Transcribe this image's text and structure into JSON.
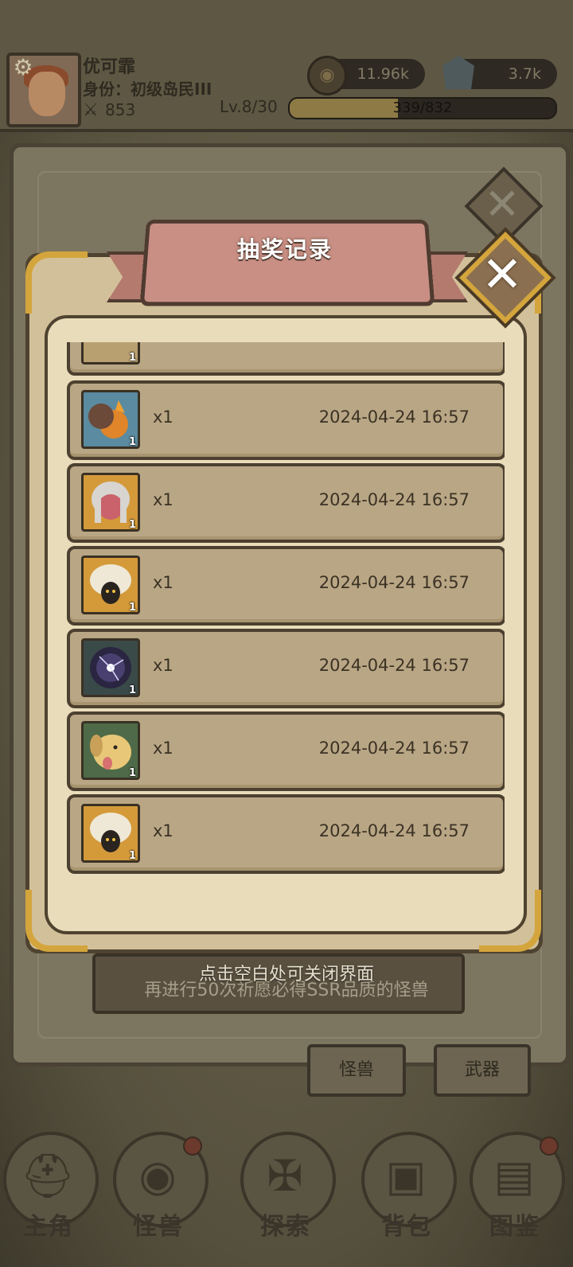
{
  "player": {
    "name": "优可霏",
    "role": "身份：初级岛民III",
    "power": "853",
    "level": "Lv.8/30",
    "xp_text": "339/832",
    "xp_progress": 0.407
  },
  "resources": {
    "coins": "11.96k",
    "gems": "3.7k"
  },
  "dialog": {
    "title": "抽奖记录",
    "records": [
      {
        "icon": "fire-beast-card-icon",
        "count": "1",
        "qty": "x1",
        "time": "2024-04-24 16:57",
        "color": "#5a8ba0"
      },
      {
        "icon": "red-girl-card-icon",
        "count": "1",
        "qty": "x1",
        "time": "2024-04-24 16:57",
        "color": "#d49a3a"
      },
      {
        "icon": "white-haired-imp-card-icon",
        "count": "1",
        "qty": "x1",
        "time": "2024-04-24 16:57",
        "color": "#d49a3a"
      },
      {
        "icon": "dark-orb-card-icon",
        "count": "1",
        "qty": "x1",
        "time": "2024-04-24 16:57",
        "color": "#3a4a48"
      },
      {
        "icon": "dog-card-icon",
        "count": "1",
        "qty": "x1",
        "time": "2024-04-24 16:57",
        "color": "#4e6a48"
      },
      {
        "icon": "white-haired-imp-card-icon",
        "count": "1",
        "qty": "x1",
        "time": "2024-04-24 16:57",
        "color": "#d49a3a"
      }
    ],
    "partial_record_count": "1"
  },
  "hints": {
    "close_hint": "点击空白处可关闭界面",
    "pity_hint": "再进行50次祈愿必得SSR品质的怪兽"
  },
  "tabs": {
    "monster": "怪兽",
    "weapon": "武器"
  },
  "nav": [
    {
      "label": "主角",
      "icon": "helmet-icon"
    },
    {
      "label": "怪兽",
      "icon": "eye-monster-icon"
    },
    {
      "label": "探索",
      "icon": "map-icon"
    },
    {
      "label": "背包",
      "icon": "backpack-icon"
    },
    {
      "label": "图鉴",
      "icon": "book-icon"
    }
  ]
}
